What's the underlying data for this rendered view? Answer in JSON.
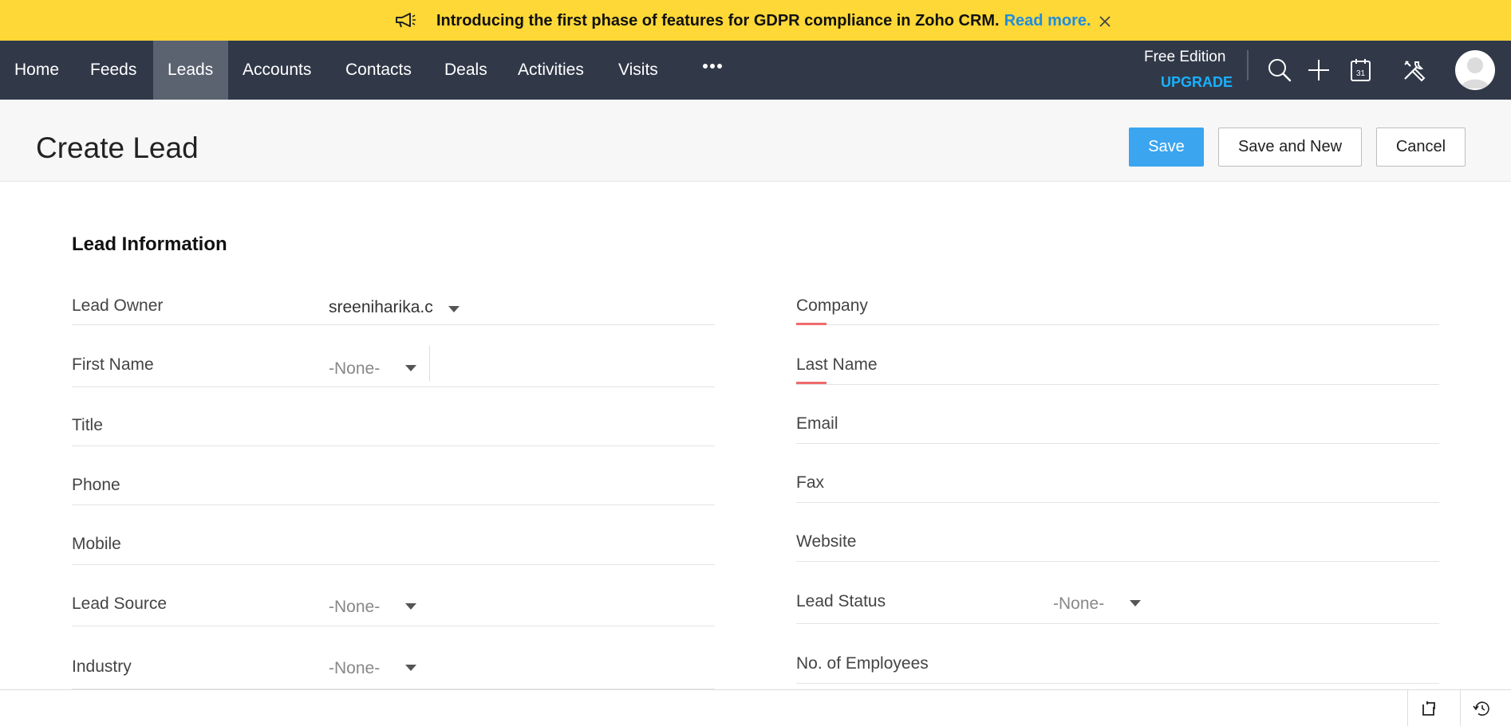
{
  "banner": {
    "message": "Introducing the first phase of features for GDPR compliance in Zoho CRM.",
    "link": "Read more.",
    "icon": "megaphone-icon",
    "close_icon": "close-icon"
  },
  "nav": {
    "tabs": [
      {
        "label": "Home"
      },
      {
        "label": "Feeds"
      },
      {
        "label": "Leads",
        "active": true
      },
      {
        "label": "Accounts"
      },
      {
        "label": "Contacts"
      },
      {
        "label": "Deals"
      },
      {
        "label": "Activities"
      },
      {
        "label": "Visits"
      }
    ],
    "more_icon": "more-horizontal-icon",
    "edition": "Free Edition",
    "upgrade": "UPGRADE",
    "icons": [
      "search-icon",
      "plus-icon",
      "calendar-icon",
      "tools-icon"
    ],
    "calendar_day": "31"
  },
  "header": {
    "title": "Create Lead",
    "save": "Save",
    "save_new": "Save and New",
    "cancel": "Cancel"
  },
  "form": {
    "section_title": "Lead Information",
    "left": {
      "lead_owner": {
        "label": "Lead Owner",
        "value": "sreeniharika.c"
      },
      "first_name": {
        "label": "First Name",
        "salutation": "-None-",
        "value": ""
      },
      "title": {
        "label": "Title",
        "value": ""
      },
      "phone": {
        "label": "Phone",
        "value": ""
      },
      "mobile": {
        "label": "Mobile",
        "value": ""
      },
      "lead_source": {
        "label": "Lead Source",
        "value": "-None-"
      },
      "industry": {
        "label": "Industry",
        "value": "-None-"
      }
    },
    "right": {
      "company": {
        "label": "Company",
        "value": "",
        "required": true
      },
      "last_name": {
        "label": "Last Name",
        "value": "",
        "required": true
      },
      "email": {
        "label": "Email",
        "value": ""
      },
      "fax": {
        "label": "Fax",
        "value": ""
      },
      "website": {
        "label": "Website",
        "value": ""
      },
      "lead_status": {
        "label": "Lead Status",
        "value": "-None-"
      },
      "employees": {
        "label": "No. of Employees",
        "value": ""
      }
    }
  },
  "footer": {
    "icons": [
      "notes-icon",
      "history-icon"
    ]
  },
  "colors": {
    "banner": "#fdd837",
    "nav": "#313949",
    "nav_active": "#5b6270",
    "primary": "#3ba5f0",
    "link": "#1f8de0",
    "upgrade": "#18b1ff",
    "required": "#ef6b6b"
  }
}
